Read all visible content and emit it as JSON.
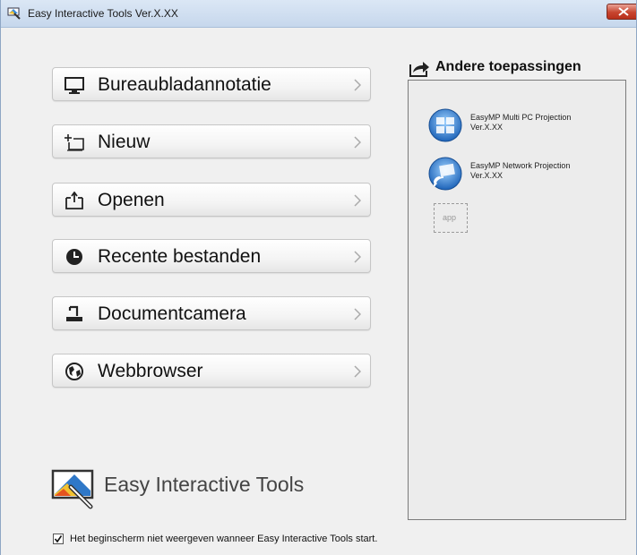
{
  "window": {
    "title": "Easy Interactive Tools Ver.X.XX"
  },
  "menu": {
    "items": [
      {
        "label": "Bureaubladannotatie",
        "icon": "monitor-icon"
      },
      {
        "label": "Nieuw",
        "icon": "new-board-icon"
      },
      {
        "label": "Openen",
        "icon": "open-folder-icon"
      },
      {
        "label": "Recente bestanden",
        "icon": "clock-icon"
      },
      {
        "label": "Documentcamera",
        "icon": "document-camera-icon"
      },
      {
        "label": "Webbrowser",
        "icon": "globe-icon"
      }
    ]
  },
  "other_apps": {
    "title": "Andere toepassingen",
    "apps": [
      {
        "name": "EasyMP Multi PC Projection",
        "version": "Ver.X.XX"
      },
      {
        "name": "EasyMP Network Projection",
        "version": "Ver.X.XX"
      }
    ],
    "placeholder": "app"
  },
  "logo": {
    "text": "Easy Interactive Tools"
  },
  "footer": {
    "checkbox_label": "Het beginscherm niet weergeven wanneer Easy Interactive Tools start.",
    "checked": true
  },
  "colors": {
    "close_button": "#c7452f",
    "app_icon_blue": "#2b7fd0"
  }
}
